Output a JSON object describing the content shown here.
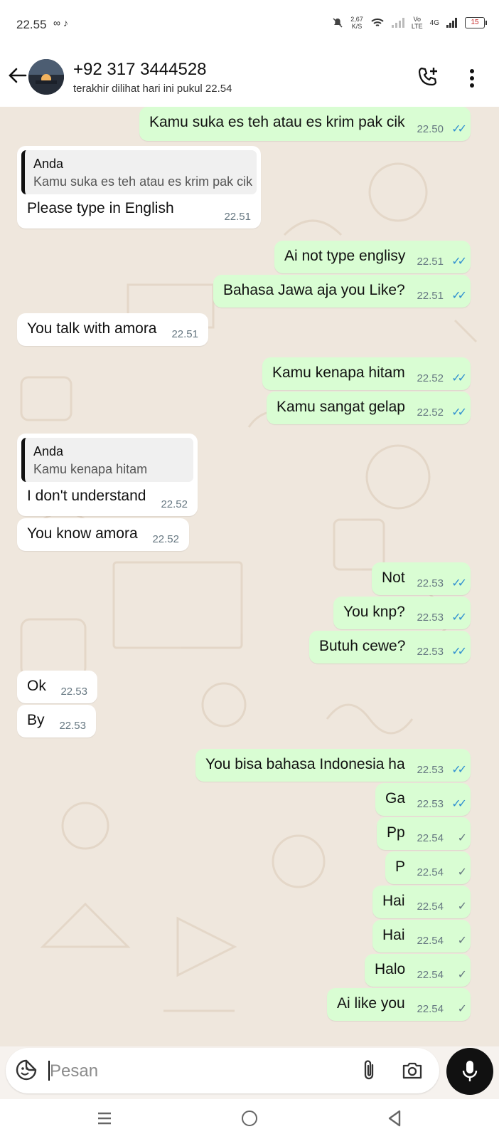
{
  "status_bar": {
    "time": "22.55",
    "left_icons": "∞ ♪",
    "speed_value": "2,67",
    "speed_unit": "K/S",
    "network_label_top": "Vo",
    "network_label_bottom": "LTE",
    "network_type": "4G",
    "battery": "15"
  },
  "header": {
    "contact": "+92 317 3444528",
    "last_seen": "terakhir dilihat hari ini pukul 22.54"
  },
  "messages": [
    {
      "dir": "out",
      "text": "Kamu suka es teh atau es krim pak cik",
      "time": "22.50",
      "status": "read"
    },
    {
      "dir": "in",
      "quote_name": "Anda",
      "quote_text": "Kamu suka es teh atau es krim pak cik",
      "text": "Please type in English",
      "time": "22.51"
    },
    {
      "dir": "out",
      "text": "Ai not type englisy",
      "time": "22.51",
      "status": "read"
    },
    {
      "dir": "out",
      "text": "Bahasa Jawa aja you Like?",
      "time": "22.51",
      "status": "read"
    },
    {
      "dir": "in",
      "text": "You talk with amora",
      "time": "22.51"
    },
    {
      "dir": "out",
      "text": "Kamu kenapa hitam",
      "time": "22.52",
      "status": "read"
    },
    {
      "dir": "out",
      "text": "Kamu sangat gelap",
      "time": "22.52",
      "status": "read"
    },
    {
      "dir": "in",
      "quote_name": "Anda",
      "quote_text": "Kamu kenapa hitam",
      "text": "I don't understand",
      "time": "22.52"
    },
    {
      "dir": "in",
      "text": "You know amora",
      "time": "22.52"
    },
    {
      "dir": "out",
      "text": "Not",
      "time": "22.53",
      "status": "read"
    },
    {
      "dir": "out",
      "text": "You knp?",
      "time": "22.53",
      "status": "read"
    },
    {
      "dir": "out",
      "text": "Butuh cewe?",
      "time": "22.53",
      "status": "read"
    },
    {
      "dir": "in",
      "text": "Ok",
      "time": "22.53"
    },
    {
      "dir": "in",
      "text": "By",
      "time": "22.53"
    },
    {
      "dir": "out",
      "text": "You bisa bahasa Indonesia ha",
      "time": "22.53",
      "status": "read"
    },
    {
      "dir": "out",
      "text": "Ga",
      "time": "22.53",
      "status": "read"
    },
    {
      "dir": "out",
      "text": "Pp",
      "time": "22.54",
      "status": "sent"
    },
    {
      "dir": "out",
      "text": "P",
      "time": "22.54",
      "status": "sent"
    },
    {
      "dir": "out",
      "text": "Hai",
      "time": "22.54",
      "status": "sent"
    },
    {
      "dir": "out",
      "text": "Hai",
      "time": "22.54",
      "status": "sent"
    },
    {
      "dir": "out",
      "text": "Halo",
      "time": "22.54",
      "status": "sent"
    },
    {
      "dir": "out",
      "text": "Ai like you",
      "time": "22.54",
      "status": "sent"
    }
  ],
  "ticks": {
    "read": "✓✓",
    "sent": "✓"
  },
  "input": {
    "placeholder": "Pesan"
  },
  "colors": {
    "outgoing_bubble": "#d9fdd3",
    "incoming_bubble": "#ffffff",
    "chat_background": "#efe7dd",
    "read_tick": "#2f8fd1",
    "mic_button": "#111111"
  }
}
